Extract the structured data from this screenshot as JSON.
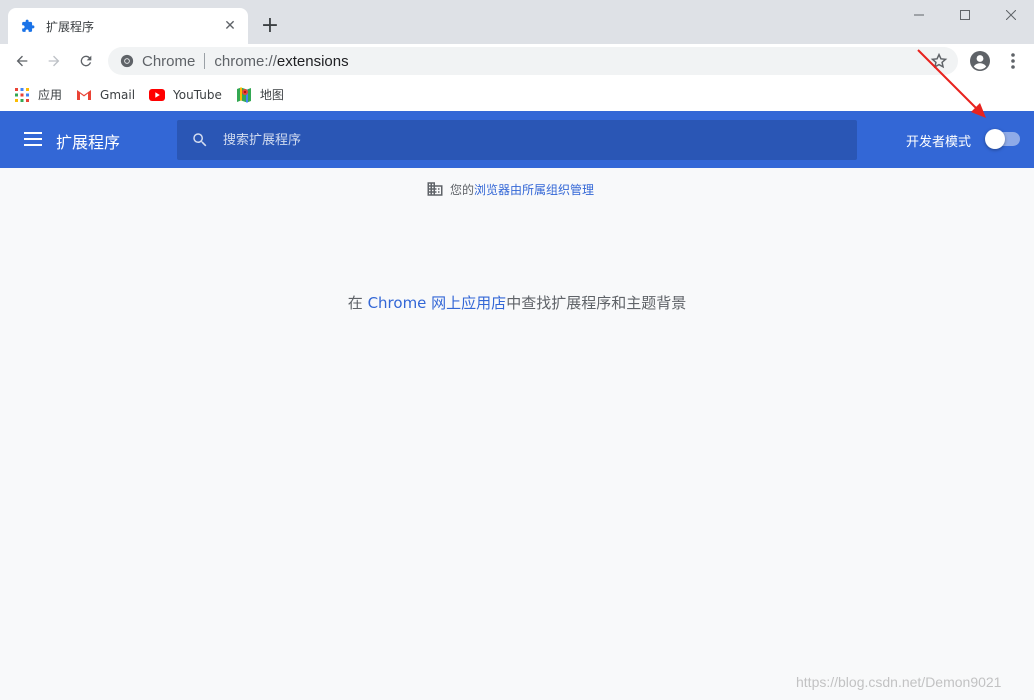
{
  "tab": {
    "title": "扩展程序",
    "close_glyph": "✕"
  },
  "newtab_glyph": "+",
  "window_controls": {
    "minimize_icon": "minimize-icon",
    "maximize_icon": "maximize-icon",
    "close_icon": "close-icon"
  },
  "omnibox": {
    "chip": "Chrome",
    "url_scheme": "chrome://",
    "url_rest": "extensions"
  },
  "bookmarks": [
    {
      "label": "应用",
      "icon": "apps-grid-icon"
    },
    {
      "label": "Gmail",
      "icon": "gmail-icon"
    },
    {
      "label": "YouTube",
      "icon": "youtube-icon"
    },
    {
      "label": "地图",
      "icon": "maps-icon"
    }
  ],
  "extensions_header": {
    "title": "扩展程序",
    "search_placeholder": "搜索扩展程序",
    "dev_mode_label": "开发者模式",
    "dev_mode_on": false
  },
  "managed_notice": {
    "prefix": "您的",
    "link": "浏览器由所属组织管理"
  },
  "store_line": {
    "prefix": "在 ",
    "link": "Chrome 网上应用店",
    "suffix": "中查找扩展程序和主题背景"
  },
  "watermark": "https://blog.csdn.net/Demon9021",
  "colors": {
    "header_blue": "#3367d6",
    "search_blue": "#2a56b5",
    "annotation_red": "#e8231f"
  }
}
